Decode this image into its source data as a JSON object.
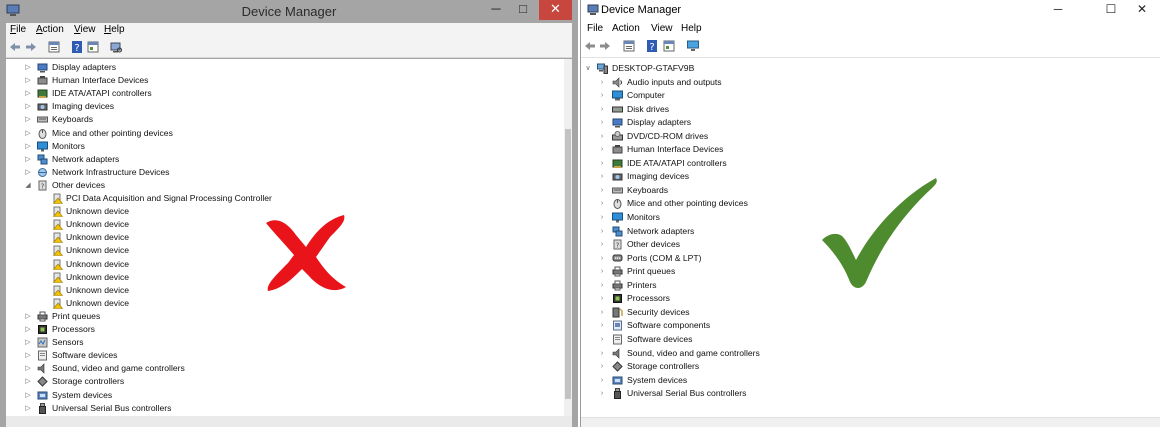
{
  "left_window": {
    "title": "Device Manager",
    "controls": {
      "minimize": "─",
      "maximize": "□",
      "close": "✕"
    },
    "menu": [
      {
        "label": "File",
        "key": "F",
        "rest": "ile"
      },
      {
        "label": "Action",
        "key": "A",
        "rest": "ction"
      },
      {
        "label": "View",
        "key": "V",
        "rest": "iew"
      },
      {
        "label": "Help",
        "key": "H",
        "rest": "elp"
      }
    ],
    "toolbar": [
      "back-icon",
      "forward-icon",
      "properties-icon",
      "help-icon",
      "update-driver-icon",
      "scan-hardware-icon"
    ],
    "tree": [
      {
        "label": "Display adapters",
        "expander": "▷",
        "icon": "display-adapter-icon",
        "level": 0
      },
      {
        "label": "Human Interface Devices",
        "expander": "▷",
        "icon": "hid-icon",
        "level": 0
      },
      {
        "label": "IDE ATA/ATAPI controllers",
        "expander": "▷",
        "icon": "ide-controller-icon",
        "level": 0
      },
      {
        "label": "Imaging devices",
        "expander": "▷",
        "icon": "camera-icon",
        "level": 0
      },
      {
        "label": "Keyboards",
        "expander": "▷",
        "icon": "keyboard-icon",
        "level": 0
      },
      {
        "label": "Mice and other pointing devices",
        "expander": "▷",
        "icon": "mouse-icon",
        "level": 0
      },
      {
        "label": "Monitors",
        "expander": "▷",
        "icon": "monitor-icon",
        "level": 0
      },
      {
        "label": "Network adapters",
        "expander": "▷",
        "icon": "network-adapter-icon",
        "level": 0
      },
      {
        "label": "Network Infrastructure Devices",
        "expander": "▷",
        "icon": "network-infrastructure-icon",
        "level": 0
      },
      {
        "label": "Other devices",
        "expander": "◢",
        "icon": "other-devices-icon",
        "level": 0
      },
      {
        "label": "PCI Data Acquisition and Signal Processing Controller",
        "expander": "",
        "icon": "warning-device-icon",
        "level": 1
      },
      {
        "label": "Unknown device",
        "expander": "",
        "icon": "warning-device-icon",
        "level": 1
      },
      {
        "label": "Unknown device",
        "expander": "",
        "icon": "warning-device-icon",
        "level": 1
      },
      {
        "label": "Unknown device",
        "expander": "",
        "icon": "warning-device-icon",
        "level": 1
      },
      {
        "label": "Unknown device",
        "expander": "",
        "icon": "warning-device-icon",
        "level": 1
      },
      {
        "label": "Unknown device",
        "expander": "",
        "icon": "warning-device-icon",
        "level": 1
      },
      {
        "label": "Unknown device",
        "expander": "",
        "icon": "warning-device-icon",
        "level": 1
      },
      {
        "label": "Unknown device",
        "expander": "",
        "icon": "warning-device-icon",
        "level": 1
      },
      {
        "label": "Unknown device",
        "expander": "",
        "icon": "warning-device-icon",
        "level": 1
      },
      {
        "label": "Print queues",
        "expander": "▷",
        "icon": "printer-icon",
        "level": 0
      },
      {
        "label": "Processors",
        "expander": "▷",
        "icon": "processor-icon",
        "level": 0
      },
      {
        "label": "Sensors",
        "expander": "▷",
        "icon": "sensor-icon",
        "level": 0
      },
      {
        "label": "Software devices",
        "expander": "▷",
        "icon": "software-device-icon",
        "level": 0
      },
      {
        "label": "Sound, video and game controllers",
        "expander": "▷",
        "icon": "speaker-icon",
        "level": 0
      },
      {
        "label": "Storage controllers",
        "expander": "▷",
        "icon": "storage-controller-icon",
        "level": 0
      },
      {
        "label": "System devices",
        "expander": "▷",
        "icon": "system-device-icon",
        "level": 0
      },
      {
        "label": "Universal Serial Bus controllers",
        "expander": "▷",
        "icon": "usb-icon",
        "level": 0
      }
    ]
  },
  "right_window": {
    "title": "Device Manager",
    "controls": {
      "minimize": "─",
      "maximize": "☐",
      "close": "✕"
    },
    "menu": [
      "File",
      "Action",
      "View",
      "Help"
    ],
    "toolbar": [
      "back-icon",
      "forward-icon",
      "properties-icon",
      "help-icon",
      "update-driver-icon",
      "monitor-icon"
    ],
    "root": {
      "label": "DESKTOP-GTAFV9B",
      "expander": "∨",
      "icon": "computer-root-icon"
    },
    "tree": [
      {
        "label": "Audio inputs and outputs",
        "icon": "audio-icon"
      },
      {
        "label": "Computer",
        "icon": "computer-icon"
      },
      {
        "label": "Disk drives",
        "icon": "disk-drive-icon"
      },
      {
        "label": "Display adapters",
        "icon": "display-adapter-icon"
      },
      {
        "label": "DVD/CD-ROM drives",
        "icon": "dvd-drive-icon"
      },
      {
        "label": "Human Interface Devices",
        "icon": "hid-icon"
      },
      {
        "label": "IDE ATA/ATAPI controllers",
        "icon": "ide-controller-icon"
      },
      {
        "label": "Imaging devices",
        "icon": "camera-icon"
      },
      {
        "label": "Keyboards",
        "icon": "keyboard-icon"
      },
      {
        "label": "Mice and other pointing devices",
        "icon": "mouse-icon"
      },
      {
        "label": "Monitors",
        "icon": "monitor-icon"
      },
      {
        "label": "Network adapters",
        "icon": "network-adapter-icon"
      },
      {
        "label": "Other devices",
        "icon": "other-devices-icon"
      },
      {
        "label": "Ports (COM & LPT)",
        "icon": "port-icon"
      },
      {
        "label": "Print queues",
        "icon": "printer-icon"
      },
      {
        "label": "Printers",
        "icon": "printer-icon"
      },
      {
        "label": "Processors",
        "icon": "processor-icon"
      },
      {
        "label": "Security devices",
        "icon": "security-device-icon"
      },
      {
        "label": "Software components",
        "icon": "software-component-icon"
      },
      {
        "label": "Software devices",
        "icon": "software-device-icon"
      },
      {
        "label": "Sound, video and game controllers",
        "icon": "speaker-icon"
      },
      {
        "label": "Storage controllers",
        "icon": "storage-controller-icon"
      },
      {
        "label": "System devices",
        "icon": "system-device-icon"
      },
      {
        "label": "Universal Serial Bus controllers",
        "icon": "usb-icon"
      }
    ],
    "expander": "›"
  },
  "overlay": {
    "cross": {
      "icon": "red-cross-icon",
      "color": "#e8141a"
    },
    "check": {
      "icon": "green-check-icon",
      "color": "#4e8a2e"
    }
  }
}
